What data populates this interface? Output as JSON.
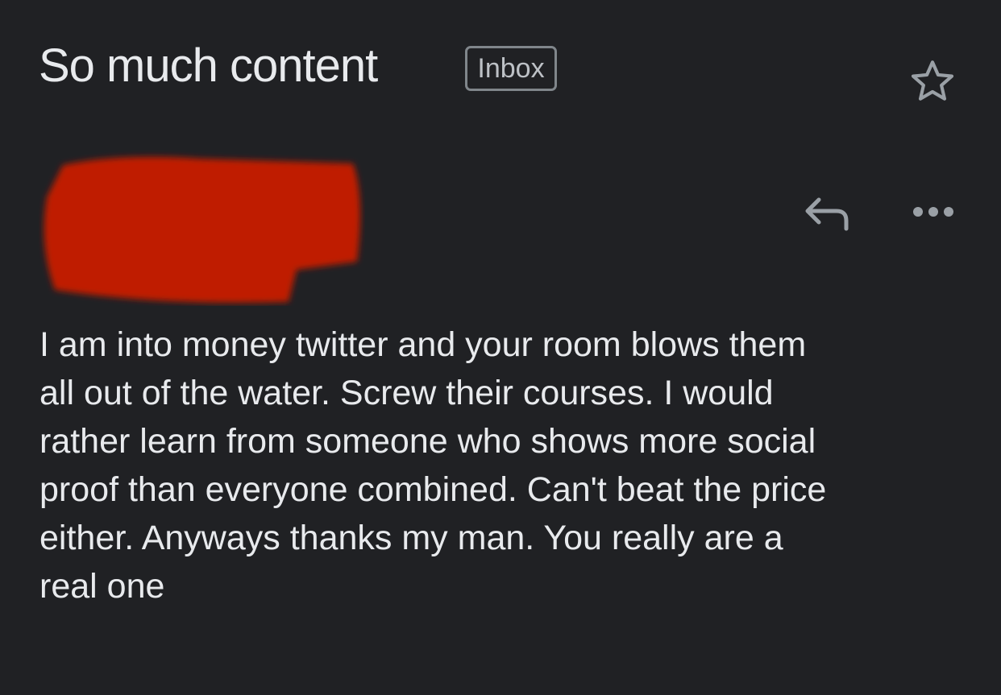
{
  "header": {
    "subject": "So much content",
    "label_badge": "Inbox",
    "star_icon": "star-outline-icon"
  },
  "sender": {
    "redacted": true,
    "redaction_color": "#c01d00",
    "reply_icon": "reply-icon",
    "more_icon": "more-horizontal-icon"
  },
  "message": {
    "lines": [
      "I am into money twitter and your room blows them",
      "all out of the water. Screw their courses. I would",
      "rather learn from someone who shows more social",
      "proof than everyone combined. Can't beat the price",
      "either. Anyways thanks my man. You really are a",
      "real one"
    ]
  },
  "colors": {
    "background": "#202124",
    "text": "#e8eaed",
    "icon": "#9aa0a6"
  }
}
